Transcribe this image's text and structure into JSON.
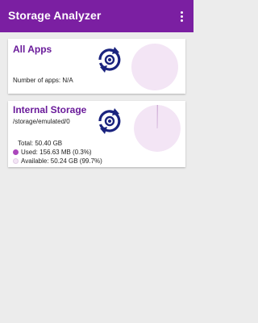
{
  "app": {
    "title": "Storage Analyzer",
    "menu_icon": "more-vert-icon"
  },
  "all_apps": {
    "title": "All Apps",
    "apps_count": "Number of apps: N/A",
    "refresh_icon": "refresh-icon"
  },
  "internal_storage": {
    "title": "Internal Storage",
    "path": "/storage/emulated/0",
    "total": "Total: 50.40 GB",
    "used": "Used: 156.63 MB (0.3%)",
    "available": "Available: 50.24 GB (99.7%)",
    "used_fraction": 0.003,
    "refresh_icon": "refresh-icon"
  },
  "colors": {
    "accent": "#7b1fa2",
    "card_title": "#6a1b9a",
    "used": "#ab47bc",
    "available": "#f3e5f5"
  }
}
